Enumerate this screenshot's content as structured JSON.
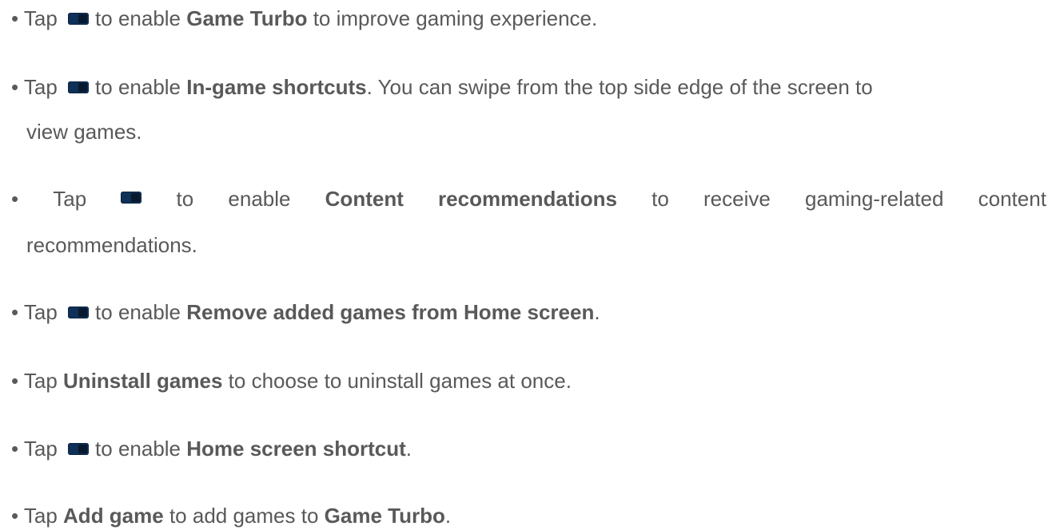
{
  "items": [
    {
      "bullet": "•",
      "pre": "Tap",
      "mid": "to enable",
      "bold": "Game Turbo",
      "post": "to improve gaming experience."
    },
    {
      "bullet": "•",
      "pre": "Tap",
      "mid": "to enable",
      "bold": "In-game shortcuts",
      "post": ". You can swipe from the top side edge of the screen to",
      "cont": "view games."
    },
    {
      "bullet": "•",
      "pre": "Tap",
      "mid_words": [
        "to",
        "enable"
      ],
      "bold_words": [
        "Content",
        "recommendations"
      ],
      "post_words": [
        "to",
        "receive",
        "gaming-related",
        "content"
      ],
      "cont": "recommendations."
    },
    {
      "bullet": "•",
      "pre": "Tap",
      "mid": "to enable",
      "bold": "Remove added games from Home screen",
      "post": "."
    },
    {
      "bullet": "•",
      "pre": "Tap",
      "bold": "Uninstall games",
      "post": "to choose to uninstall games at once."
    },
    {
      "bullet": "•",
      "pre": "Tap",
      "mid": "to enable",
      "bold": "Home screen shortcut",
      "post": "."
    },
    {
      "bullet": "•",
      "pre": "Tap",
      "bold": "Add game",
      "post": "to add games to",
      "bold2": "Game Turbo",
      "post2": "."
    }
  ],
  "icons": {
    "toggle": "toggle-switch-icon",
    "toggle_color": "#0f3057"
  },
  "colors": {
    "text": "#595959",
    "background": "#ffffff"
  }
}
